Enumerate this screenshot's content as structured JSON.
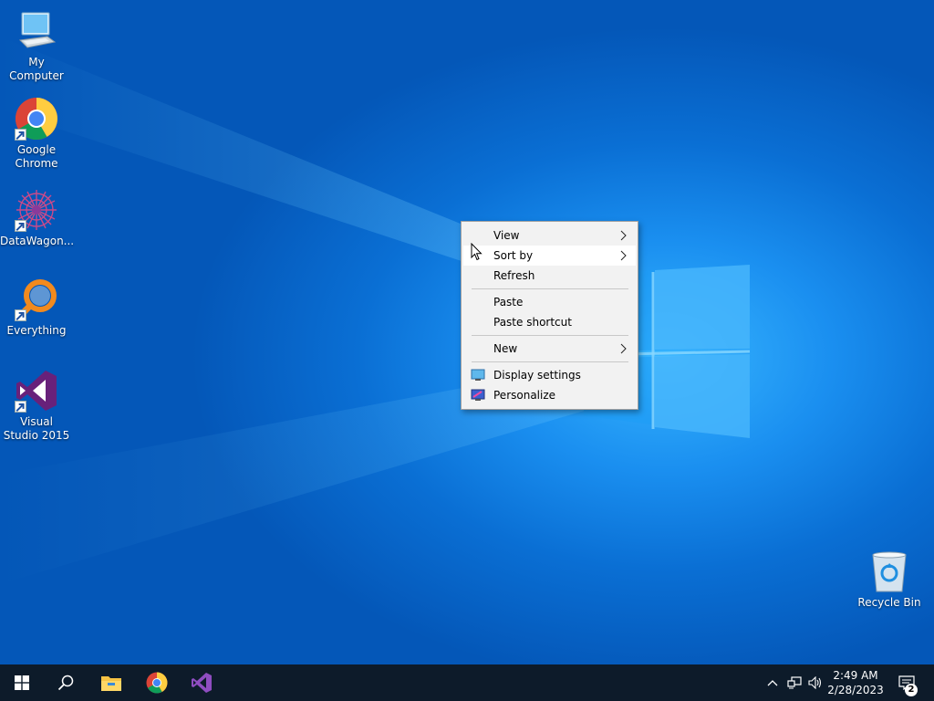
{
  "desktop": {
    "icons": [
      {
        "label": "My Computer",
        "icon": "monitor-icon"
      },
      {
        "label": "Google Chrome",
        "icon": "chrome-icon",
        "shortcut": true
      },
      {
        "label": "DataWagon...",
        "icon": "datawagon-icon",
        "shortcut": true
      },
      {
        "label": "Everything",
        "icon": "search-magnifier-icon",
        "shortcut": true
      },
      {
        "label": "Visual Studio 2015",
        "icon": "visual-studio-icon",
        "shortcut": true
      },
      {
        "label": "Recycle Bin",
        "icon": "recycle-bin-icon"
      }
    ]
  },
  "context_menu": {
    "items": [
      {
        "label": "View",
        "submenu": true
      },
      {
        "label": "Sort by",
        "submenu": true,
        "highlighted": true
      },
      {
        "label": "Refresh"
      },
      {
        "label": "Paste"
      },
      {
        "label": "Paste shortcut"
      },
      {
        "label": "New",
        "submenu": true
      },
      {
        "label": "Display settings",
        "icon": "display-settings-icon"
      },
      {
        "label": "Personalize",
        "icon": "personalize-icon"
      }
    ]
  },
  "taskbar": {
    "buttons": [
      "windows-start-icon",
      "search-icon",
      "file-explorer-icon",
      "chrome-icon",
      "visual-studio-icon"
    ],
    "tray": [
      "chevron-up-icon",
      "network-icon",
      "volume-icon"
    ],
    "clock": {
      "time": "2:49 AM",
      "date": "2/28/2023"
    },
    "notifications": {
      "count": "2",
      "icon": "action-center-icon"
    }
  },
  "colors": {
    "desktop_accent": "#0078d7",
    "taskbar": "#0d1b2a",
    "menu_bg": "#f2f2f2",
    "menu_hover": "#ffffff"
  }
}
